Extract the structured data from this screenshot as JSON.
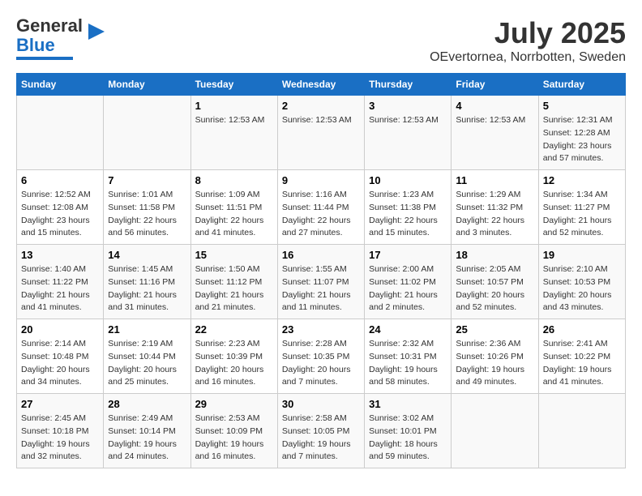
{
  "header": {
    "logo_general": "General",
    "logo_blue": "Blue",
    "title": "July 2025",
    "subtitle": "OEvertornea, Norrbotten, Sweden"
  },
  "days_of_week": [
    "Sunday",
    "Monday",
    "Tuesday",
    "Wednesday",
    "Thursday",
    "Friday",
    "Saturday"
  ],
  "weeks": [
    {
      "days": [
        {
          "num": "",
          "info": ""
        },
        {
          "num": "",
          "info": ""
        },
        {
          "num": "1",
          "info": "Sunrise: 12:53 AM"
        },
        {
          "num": "2",
          "info": "Sunrise: 12:53 AM"
        },
        {
          "num": "3",
          "info": "Sunrise: 12:53 AM"
        },
        {
          "num": "4",
          "info": "Sunrise: 12:53 AM"
        },
        {
          "num": "5",
          "info": "Sunrise: 12:31 AM\nSunset: 12:28 AM\nDaylight: 23 hours and 57 minutes."
        }
      ]
    },
    {
      "days": [
        {
          "num": "6",
          "info": "Sunrise: 12:52 AM\nSunset: 12:08 AM\nDaylight: 23 hours and 15 minutes."
        },
        {
          "num": "7",
          "info": "Sunrise: 1:01 AM\nSunset: 11:58 PM\nDaylight: 22 hours and 56 minutes."
        },
        {
          "num": "8",
          "info": "Sunrise: 1:09 AM\nSunset: 11:51 PM\nDaylight: 22 hours and 41 minutes."
        },
        {
          "num": "9",
          "info": "Sunrise: 1:16 AM\nSunset: 11:44 PM\nDaylight: 22 hours and 27 minutes."
        },
        {
          "num": "10",
          "info": "Sunrise: 1:23 AM\nSunset: 11:38 PM\nDaylight: 22 hours and 15 minutes."
        },
        {
          "num": "11",
          "info": "Sunrise: 1:29 AM\nSunset: 11:32 PM\nDaylight: 22 hours and 3 minutes."
        },
        {
          "num": "12",
          "info": "Sunrise: 1:34 AM\nSunset: 11:27 PM\nDaylight: 21 hours and 52 minutes."
        }
      ]
    },
    {
      "days": [
        {
          "num": "13",
          "info": "Sunrise: 1:40 AM\nSunset: 11:22 PM\nDaylight: 21 hours and 41 minutes."
        },
        {
          "num": "14",
          "info": "Sunrise: 1:45 AM\nSunset: 11:16 PM\nDaylight: 21 hours and 31 minutes."
        },
        {
          "num": "15",
          "info": "Sunrise: 1:50 AM\nSunset: 11:12 PM\nDaylight: 21 hours and 21 minutes."
        },
        {
          "num": "16",
          "info": "Sunrise: 1:55 AM\nSunset: 11:07 PM\nDaylight: 21 hours and 11 minutes."
        },
        {
          "num": "17",
          "info": "Sunrise: 2:00 AM\nSunset: 11:02 PM\nDaylight: 21 hours and 2 minutes."
        },
        {
          "num": "18",
          "info": "Sunrise: 2:05 AM\nSunset: 10:57 PM\nDaylight: 20 hours and 52 minutes."
        },
        {
          "num": "19",
          "info": "Sunrise: 2:10 AM\nSunset: 10:53 PM\nDaylight: 20 hours and 43 minutes."
        }
      ]
    },
    {
      "days": [
        {
          "num": "20",
          "info": "Sunrise: 2:14 AM\nSunset: 10:48 PM\nDaylight: 20 hours and 34 minutes."
        },
        {
          "num": "21",
          "info": "Sunrise: 2:19 AM\nSunset: 10:44 PM\nDaylight: 20 hours and 25 minutes."
        },
        {
          "num": "22",
          "info": "Sunrise: 2:23 AM\nSunset: 10:39 PM\nDaylight: 20 hours and 16 minutes."
        },
        {
          "num": "23",
          "info": "Sunrise: 2:28 AM\nSunset: 10:35 PM\nDaylight: 20 hours and 7 minutes."
        },
        {
          "num": "24",
          "info": "Sunrise: 2:32 AM\nSunset: 10:31 PM\nDaylight: 19 hours and 58 minutes."
        },
        {
          "num": "25",
          "info": "Sunrise: 2:36 AM\nSunset: 10:26 PM\nDaylight: 19 hours and 49 minutes."
        },
        {
          "num": "26",
          "info": "Sunrise: 2:41 AM\nSunset: 10:22 PM\nDaylight: 19 hours and 41 minutes."
        }
      ]
    },
    {
      "days": [
        {
          "num": "27",
          "info": "Sunrise: 2:45 AM\nSunset: 10:18 PM\nDaylight: 19 hours and 32 minutes."
        },
        {
          "num": "28",
          "info": "Sunrise: 2:49 AM\nSunset: 10:14 PM\nDaylight: 19 hours and 24 minutes."
        },
        {
          "num": "29",
          "info": "Sunrise: 2:53 AM\nSunset: 10:09 PM\nDaylight: 19 hours and 16 minutes."
        },
        {
          "num": "30",
          "info": "Sunrise: 2:58 AM\nSunset: 10:05 PM\nDaylight: 19 hours and 7 minutes."
        },
        {
          "num": "31",
          "info": "Sunrise: 3:02 AM\nSunset: 10:01 PM\nDaylight: 18 hours and 59 minutes."
        },
        {
          "num": "",
          "info": ""
        },
        {
          "num": "",
          "info": ""
        }
      ]
    }
  ]
}
